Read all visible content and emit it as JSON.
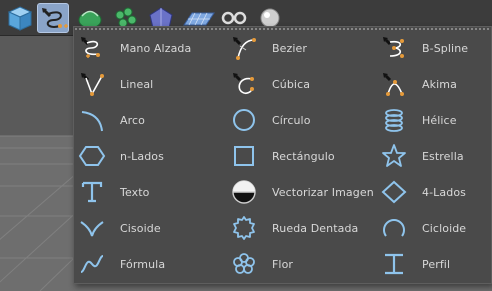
{
  "accent_color": "#8fc4ec",
  "toolbar": {
    "tools": [
      {
        "name": "cube-tool",
        "icon": "cube-icon"
      },
      {
        "name": "spline-tool",
        "icon": "spline-pen-icon",
        "active": true
      },
      {
        "name": "nurbs-tool",
        "icon": "nurbs-icon"
      },
      {
        "name": "array-tool",
        "icon": "array-icon"
      },
      {
        "name": "deformer-tool",
        "icon": "deformer-icon"
      },
      {
        "name": "floor-tool",
        "icon": "floor-icon"
      },
      {
        "name": "camera-tool",
        "icon": "camera-icon"
      },
      {
        "name": "light-tool",
        "icon": "light-icon"
      }
    ]
  },
  "menu": {
    "columns": [
      [
        {
          "label": "Mano Alzada",
          "icon": "freehand-icon"
        },
        {
          "label": "Lineal",
          "icon": "linear-icon"
        },
        {
          "label": "Arco",
          "icon": "arc-icon"
        },
        {
          "label": "n-Lados",
          "icon": "hexagon-icon"
        },
        {
          "label": "Texto",
          "icon": "text-icon"
        },
        {
          "label": "Cisoide",
          "icon": "cissoid-icon"
        },
        {
          "label": "Fórmula",
          "icon": "formula-icon"
        }
      ],
      [
        {
          "label": "Bezier",
          "icon": "bezier-icon"
        },
        {
          "label": "Cúbica",
          "icon": "cubic-icon"
        },
        {
          "label": "Círculo",
          "icon": "circle-icon"
        },
        {
          "label": "Rectángulo",
          "icon": "rectangle-icon"
        },
        {
          "label": "Vectorizar Imagen",
          "icon": "vectorize-image-icon"
        },
        {
          "label": "Rueda Dentada",
          "icon": "gear-icon"
        },
        {
          "label": "Flor",
          "icon": "flower-icon"
        }
      ],
      [
        {
          "label": "B-Spline",
          "icon": "bspline-icon"
        },
        {
          "label": "Akima",
          "icon": "akima-icon"
        },
        {
          "label": "Hélice",
          "icon": "helix-icon"
        },
        {
          "label": "Estrella",
          "icon": "star-icon"
        },
        {
          "label": "4-Lados",
          "icon": "diamond-icon"
        },
        {
          "label": "Cicloide",
          "icon": "cycloid-icon"
        },
        {
          "label": "Perfil",
          "icon": "profile-icon"
        }
      ]
    ]
  }
}
